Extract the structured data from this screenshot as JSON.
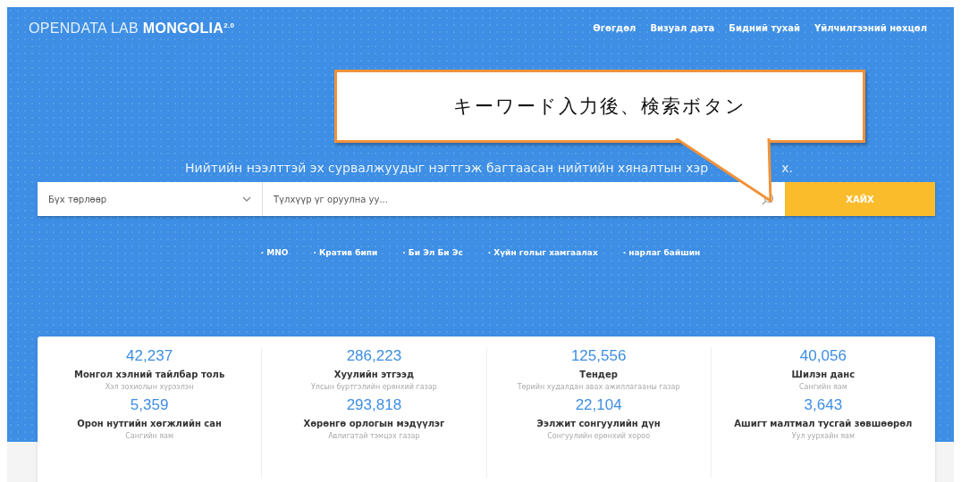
{
  "logo": {
    "light": "OPENDATA LAB ",
    "bold": "MONGOLIA",
    "version": "2.0"
  },
  "nav": [
    "Өгөгдөл",
    "Визуал дата",
    "Бидний тухай",
    "Үйлчилгээний нөхцөл"
  ],
  "callout": {
    "text": "キーワード入力後、検索ボタン"
  },
  "tagline": {
    "visible_start": "Нийтийн нээлттэй эх сурвалжуудыг нэгтгэж багтаасан нийтийн хяналтын хэр",
    "visible_end": "х."
  },
  "search": {
    "category": "Бүх төрлөөр",
    "placeholder": "Түлхүүр үг оруулна уу...",
    "button": "ХАЙХ"
  },
  "tags": [
    "· MNO",
    "· Кратив бипи",
    "· Би Эл Би Эс",
    "· Хүйн голыг хамгаалах",
    "· нарлаг байшин"
  ],
  "stats": [
    {
      "number": "42,237",
      "title": "Монгол хэлний тайлбар толь",
      "source": "Хэл зохиолын хүрээлэн"
    },
    {
      "number": "286,223",
      "title": "Хуулийн этгээд",
      "source": "Улсын бүртгэлийн ерөнхий газар"
    },
    {
      "number": "125,556",
      "title": "Тендер",
      "source": "Төрийн худалдан авах ажиллагааны газар"
    },
    {
      "number": "40,056",
      "title": "Шилэн данс",
      "source": "Сангийн яам"
    },
    {
      "number": "5,359",
      "title": "Орон нутгийн хөгжлийн сан",
      "source": "Сангийн яам"
    },
    {
      "number": "293,818",
      "title": "Хөрөнгө орлогын мэдүүлэг",
      "source": "Авлигатай тэмцэх газар"
    },
    {
      "number": "22,104",
      "title": "Ээлжит сонгуулийн дүн",
      "source": "Сонгуулийн ерөнхий хороо"
    },
    {
      "number": "3,643",
      "title": "Ашигт малтмал тусгай зөвшөөрөл",
      "source": "Уул уурхайн яам"
    }
  ]
}
